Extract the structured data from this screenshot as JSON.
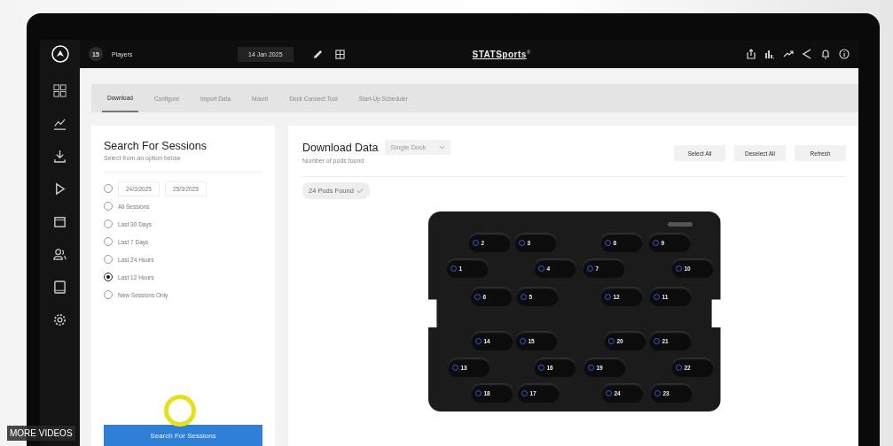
{
  "top_bar": {
    "player_count": "15",
    "players_label": "Players",
    "date": "14 Jan 2025",
    "logo": "STATSports",
    "logo_mark": "®"
  },
  "tabs": [
    {
      "label": "Download",
      "selected": true
    },
    {
      "label": "Configure",
      "selected": false
    },
    {
      "label": "Import Data",
      "selected": false
    },
    {
      "label": "Mount",
      "selected": false
    },
    {
      "label": "Dock Connect Tool",
      "selected": false
    },
    {
      "label": "Start-Up Scheduler",
      "selected": false
    }
  ],
  "search_panel": {
    "title": "Search For Sessions",
    "subtitle": "Select from an option below",
    "options": [
      {
        "kind": "range",
        "from": "24/3/2025",
        "to": "25/3/2025",
        "selected": false
      },
      {
        "kind": "option",
        "label": "All Sessions",
        "selected": false
      },
      {
        "kind": "option",
        "label": "Last 30 Days",
        "selected": false
      },
      {
        "kind": "option",
        "label": "Last 7 Days",
        "selected": false
      },
      {
        "kind": "option",
        "label": "Last 24 Hours",
        "selected": false
      },
      {
        "kind": "option",
        "label": "Last 12 Hours",
        "selected": true
      },
      {
        "kind": "option",
        "label": "New Sessions Only",
        "selected": false
      }
    ],
    "search_button": "Search For Sessions"
  },
  "download_panel": {
    "title": "Download Data",
    "dock_select": "Single Dock",
    "subtitle": "Number of pods found",
    "buttons": [
      "Select All",
      "Deselect All",
      "Refresh"
    ],
    "pods_found": "24 Pods Found",
    "pods": [
      "2",
      "3",
      "8",
      "9",
      "1",
      "4",
      "7",
      "10",
      "6",
      "5",
      "12",
      "11",
      "14",
      "15",
      "20",
      "21",
      "13",
      "16",
      "19",
      "22",
      "18",
      "17",
      "24",
      "23"
    ]
  },
  "overlay": {
    "more_videos": "MORE VIDEOS"
  }
}
